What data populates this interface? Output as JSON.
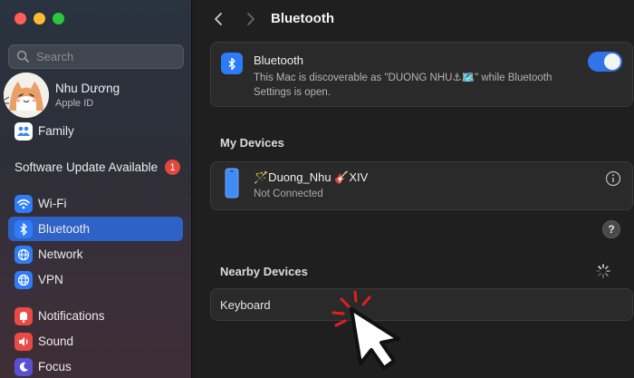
{
  "window": {
    "title": "Bluetooth"
  },
  "sidebar": {
    "search": {
      "placeholder": "Search",
      "value": ""
    },
    "profile": {
      "name": "Nhu Dương",
      "subtitle": "Apple ID"
    },
    "family": {
      "label": "Family",
      "icon": "family-icon"
    },
    "software_update": {
      "label": "Software Update Available",
      "badge": "1"
    },
    "items": [
      {
        "label": "Wi-Fi",
        "icon": "wifi-icon",
        "active": false
      },
      {
        "label": "Bluetooth",
        "icon": "bluetooth-icon",
        "active": true
      },
      {
        "label": "Network",
        "icon": "globe-icon",
        "active": false
      },
      {
        "label": "VPN",
        "icon": "vpn-globe-icon",
        "active": false
      },
      {
        "label": "Notifications",
        "icon": "notifications-icon",
        "active": false
      },
      {
        "label": "Sound",
        "icon": "sound-icon",
        "active": false
      },
      {
        "label": "Focus",
        "icon": "focus-moon-icon",
        "active": false
      }
    ]
  },
  "bluetooth": {
    "title": "Bluetooth",
    "description": "This Mac is discoverable as \"DUONG NHU⚓🗺️\" while Bluetooth Settings is open.",
    "enabled": true
  },
  "my_devices": {
    "title": "My Devices",
    "devices": [
      {
        "name": "🪄Duong_Nhu 🎸XIV",
        "status": "Not Connected",
        "icon": "iphone-icon"
      }
    ]
  },
  "help_label": "?",
  "nearby_devices": {
    "title": "Nearby Devices",
    "devices": [
      {
        "name": "Keyboard"
      }
    ]
  },
  "colors": {
    "accent": "#2f62c7",
    "toggle_on": "#2f74e8",
    "badge": "#e5473e"
  }
}
